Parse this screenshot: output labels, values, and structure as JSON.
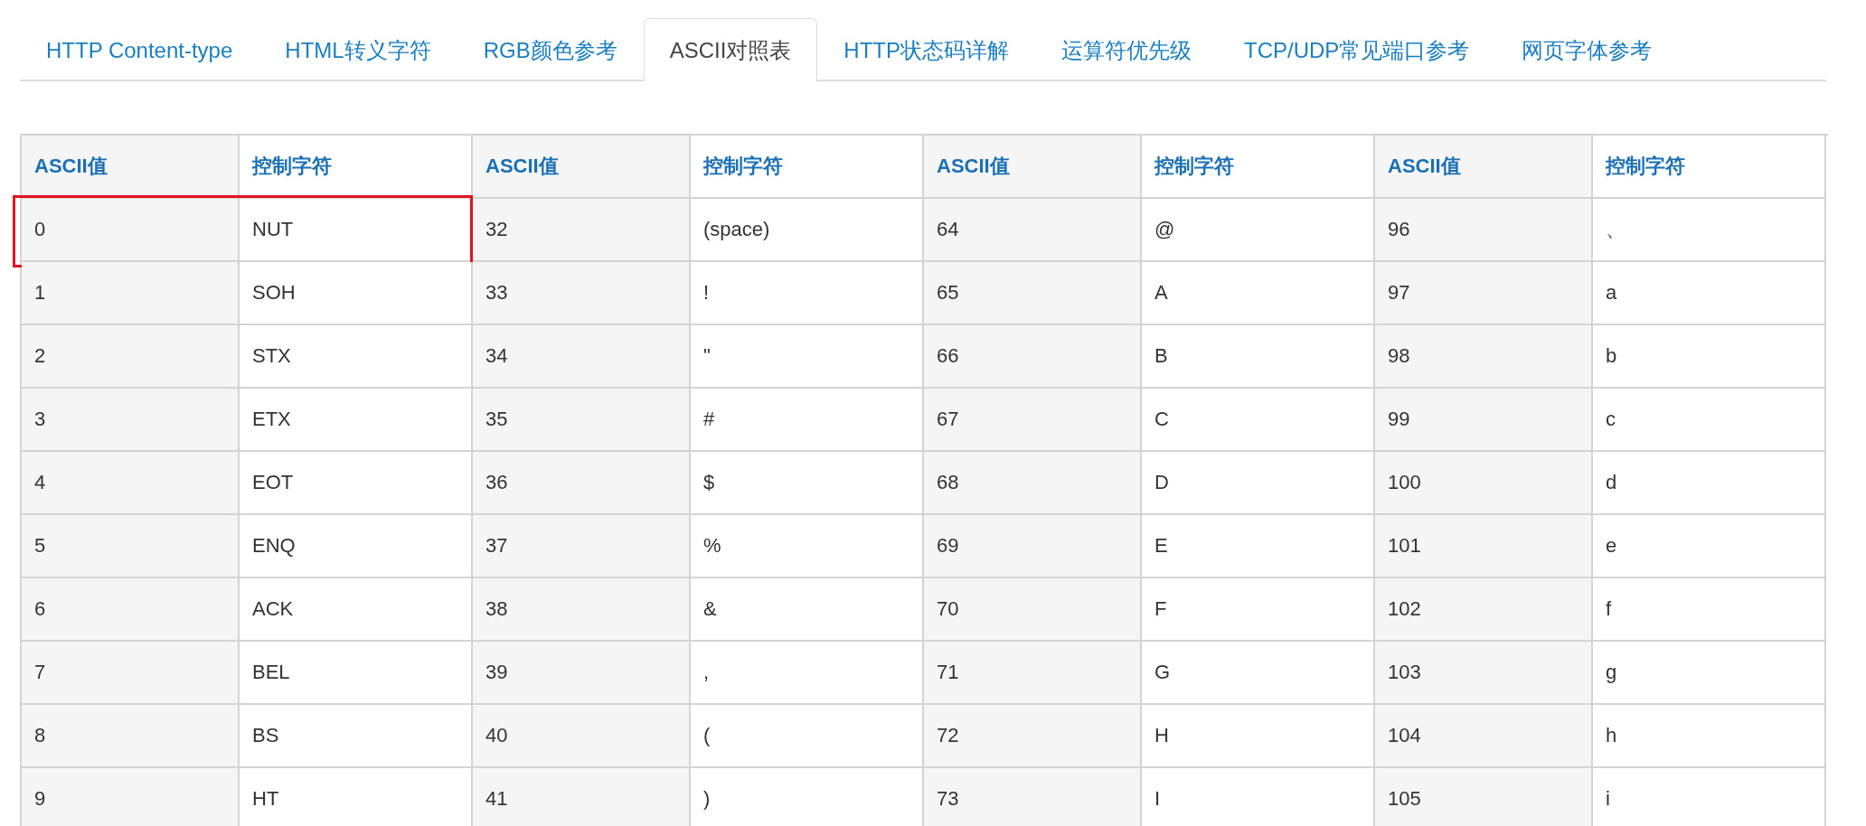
{
  "tabs": [
    {
      "label": "HTTP Content-type",
      "selected": false
    },
    {
      "label": "HTML转义字符",
      "selected": false
    },
    {
      "label": "RGB颜色参考",
      "selected": false
    },
    {
      "label": "ASCII对照表",
      "selected": true
    },
    {
      "label": "HTTP状态码详解",
      "selected": false
    },
    {
      "label": "运算符优先级",
      "selected": false
    },
    {
      "label": "TCP/UDP常见端口参考",
      "selected": false
    },
    {
      "label": "网页字体参考",
      "selected": false
    }
  ],
  "table": {
    "columns": [
      "ASCII值",
      "控制字符",
      "ASCII值",
      "控制字符",
      "ASCII值",
      "控制字符",
      "ASCII值",
      "控制字符"
    ],
    "rows": [
      {
        "pairs": [
          {
            "value": "0",
            "char": "NUT",
            "highlighted": true
          },
          {
            "value": "32",
            "char": "(space)",
            "highlighted": false
          },
          {
            "value": "64",
            "char": "@",
            "highlighted": false
          },
          {
            "value": "96",
            "char": "、",
            "highlighted": false
          }
        ]
      },
      {
        "pairs": [
          {
            "value": "1",
            "char": "SOH",
            "highlighted": false
          },
          {
            "value": "33",
            "char": "!",
            "highlighted": false
          },
          {
            "value": "65",
            "char": "A",
            "highlighted": false
          },
          {
            "value": "97",
            "char": "a",
            "highlighted": false
          }
        ]
      },
      {
        "pairs": [
          {
            "value": "2",
            "char": "STX",
            "highlighted": false
          },
          {
            "value": "34",
            "char": "\"",
            "highlighted": false
          },
          {
            "value": "66",
            "char": "B",
            "highlighted": false
          },
          {
            "value": "98",
            "char": "b",
            "highlighted": false
          }
        ]
      },
      {
        "pairs": [
          {
            "value": "3",
            "char": "ETX",
            "highlighted": false
          },
          {
            "value": "35",
            "char": "#",
            "highlighted": false
          },
          {
            "value": "67",
            "char": "C",
            "highlighted": false
          },
          {
            "value": "99",
            "char": "c",
            "highlighted": false
          }
        ]
      },
      {
        "pairs": [
          {
            "value": "4",
            "char": "EOT",
            "highlighted": false
          },
          {
            "value": "36",
            "char": "$",
            "highlighted": false
          },
          {
            "value": "68",
            "char": "D",
            "highlighted": false
          },
          {
            "value": "100",
            "char": "d",
            "highlighted": false
          }
        ]
      },
      {
        "pairs": [
          {
            "value": "5",
            "char": "ENQ",
            "highlighted": false
          },
          {
            "value": "37",
            "char": "%",
            "highlighted": false
          },
          {
            "value": "69",
            "char": "E",
            "highlighted": false
          },
          {
            "value": "101",
            "char": "e",
            "highlighted": false
          }
        ]
      },
      {
        "pairs": [
          {
            "value": "6",
            "char": "ACK",
            "highlighted": false
          },
          {
            "value": "38",
            "char": "&",
            "highlighted": false
          },
          {
            "value": "70",
            "char": "F",
            "highlighted": false
          },
          {
            "value": "102",
            "char": "f",
            "highlighted": false
          }
        ]
      },
      {
        "pairs": [
          {
            "value": "7",
            "char": "BEL",
            "highlighted": false
          },
          {
            "value": "39",
            "char": ",",
            "highlighted": false
          },
          {
            "value": "71",
            "char": "G",
            "highlighted": false
          },
          {
            "value": "103",
            "char": "g",
            "highlighted": false
          }
        ]
      },
      {
        "pairs": [
          {
            "value": "8",
            "char": "BS",
            "highlighted": false
          },
          {
            "value": "40",
            "char": "(",
            "highlighted": false
          },
          {
            "value": "72",
            "char": "H",
            "highlighted": false
          },
          {
            "value": "104",
            "char": "h",
            "highlighted": false
          }
        ]
      },
      {
        "pairs": [
          {
            "value": "9",
            "char": "HT",
            "highlighted": false
          },
          {
            "value": "41",
            "char": ")",
            "highlighted": false
          },
          {
            "value": "73",
            "char": "I",
            "highlighted": false
          },
          {
            "value": "105",
            "char": "i",
            "highlighted": false
          }
        ]
      }
    ]
  }
}
